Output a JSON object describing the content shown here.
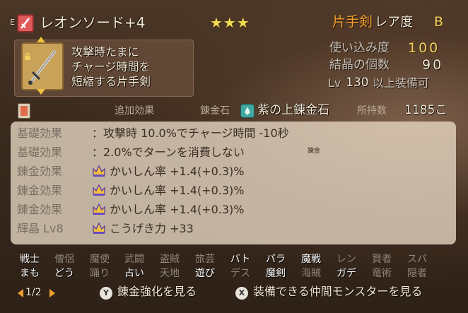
{
  "header": {
    "equip_tag": "E",
    "item_name": "レオンソード+4",
    "stars": "★★★",
    "weapon_type": "片手剣",
    "rarity_label": "レア度",
    "rarity_value": "B"
  },
  "description": {
    "lines": [
      "攻撃時たまに",
      "チャージ時間を",
      "短縮する片手剣"
    ]
  },
  "stats": {
    "usage_label": "使い込み度",
    "usage_value": "100",
    "crystal_label": "結晶の個数",
    "crystal_value": "90",
    "level_prefix": "Lv",
    "level_value": "130",
    "level_suffix": "以上装備可"
  },
  "alchemy_bar": {
    "added_effect_label": "追加効果",
    "alchemy_stone_label": "錬金石",
    "stone_name": "紫の上錬金石",
    "owned_label": "所持数",
    "owned_value": "1185こ"
  },
  "effects": [
    {
      "label": "基礎効果",
      "text": "：攻撃時 10.0%でチャージ時間 -10秒",
      "has_crown": false
    },
    {
      "label": "基礎効果",
      "text": "：2.0%でターンを消費しない",
      "suffix": "錬金",
      "has_crown": false
    },
    {
      "label": "錬金効果",
      "text": "かいしん率 +1.4(+0.3)%",
      "has_crown": true
    },
    {
      "label": "錬金効果",
      "text": "かいしん率 +1.4(+0.3)%",
      "has_crown": true
    },
    {
      "label": "錬金効果",
      "text": "かいしん率 +1.4(+0.3)%",
      "has_crown": true
    },
    {
      "label": "輝晶 Lv8",
      "text": "こうげき力 +33",
      "has_crown": true
    }
  ],
  "jobs_top": [
    {
      "label": "戦士",
      "active": true
    },
    {
      "label": "僧侶",
      "active": false
    },
    {
      "label": "魔使",
      "active": false
    },
    {
      "label": "武闘",
      "active": false
    },
    {
      "label": "盗賊",
      "active": false
    },
    {
      "label": "旅芸",
      "active": false
    },
    {
      "label": "バト",
      "active": true
    },
    {
      "label": "パラ",
      "active": true
    },
    {
      "label": "魔戦",
      "active": true
    },
    {
      "label": "レン",
      "active": false
    },
    {
      "label": "賢者",
      "active": false
    },
    {
      "label": "スパ",
      "active": false
    }
  ],
  "jobs_bottom": [
    {
      "label": "まも",
      "active": true
    },
    {
      "label": "どう",
      "active": true
    },
    {
      "label": "踊り",
      "active": false
    },
    {
      "label": "占い",
      "active": true
    },
    {
      "label": "天地",
      "active": false
    },
    {
      "label": "遊び",
      "active": true
    },
    {
      "label": "デス",
      "active": false
    },
    {
      "label": "魔剣",
      "active": true
    },
    {
      "label": "海賊",
      "active": false
    },
    {
      "label": "ガデ",
      "active": true
    },
    {
      "label": "竜術",
      "active": false
    },
    {
      "label": "隠者",
      "active": false
    }
  ],
  "footer": {
    "page": "1/2",
    "y_button": "Y",
    "y_action": "錬金強化を見る",
    "x_button": "X",
    "x_action": "装備できる仲間モンスターを見る"
  },
  "colors": {
    "star": "#f2dc52",
    "usage_value": "#f0d060",
    "weapon_type": "#f0a030",
    "active_job": "#ffffff",
    "inactive_job": "#8f857a"
  }
}
